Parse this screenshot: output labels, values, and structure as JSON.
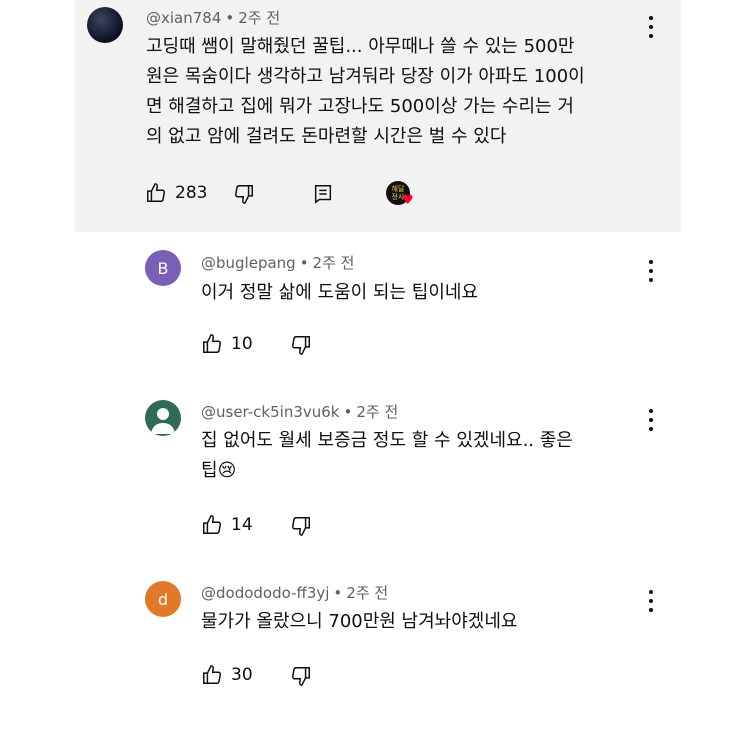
{
  "comments": [
    {
      "author": "@xian784",
      "time": "2주 전",
      "lines": [
        "고딩때 쌤이 말해줬던 꿀팁... 아무때나 쓸 수 있는 500만",
        "원은 목숨이다 생각하고 남겨둬라 당장 이가 아파도 100이",
        "면 해결하고 집에 뭐가 고장나도 500이상 가는 수리는 거",
        "의 없고 암에 걸려도 돈마련할 시간은 벌 수 있다"
      ],
      "likes": "283",
      "avatar_color": "#1a2233"
    },
    {
      "author": "@buglepang",
      "time": "2주 전",
      "lines": [
        "이거 정말 삶에 도움이 되는 팁이네요"
      ],
      "likes": "10",
      "avatar_letter": "B",
      "avatar_color": "#7b5fb5"
    },
    {
      "author": "@user-ck5in3vu6k",
      "time": "2주 전",
      "lines": [
        "집 없어도 월세 보증금 정도 할 수 있겠네요.. 좋은",
        "팁"
      ],
      "emoji": "😢",
      "likes": "14",
      "avatar_color": "#2f6b57"
    },
    {
      "author": "@dodododo-ff3yj",
      "time": "2주 전",
      "lines": [
        "물가가 올랐으니 700만원 남겨놔야겠네요"
      ],
      "likes": "30",
      "avatar_letter": "d",
      "avatar_color": "#e07a2a"
    }
  ],
  "creator_badge_text": "해달\n정사"
}
